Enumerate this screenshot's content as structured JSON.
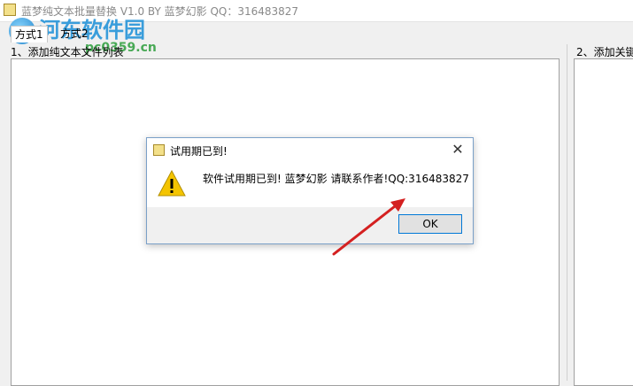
{
  "window": {
    "title": "蓝梦纯文本批量替换 V1.0 BY 蓝梦幻影 QQ：316483827"
  },
  "watermark": {
    "text": "河东软件园",
    "url": "pc0359.cn"
  },
  "tabs": [
    {
      "label": "方式1"
    },
    {
      "label": "方式2"
    }
  ],
  "sections": {
    "left_label": "1、添加纯文本文件列表",
    "right_label": "2、添加关键"
  },
  "dialog": {
    "title": "试用期已到!",
    "message": "软件试用期已到! 蓝梦幻影 请联系作者!QQ:316483827",
    "ok_label": "OK",
    "close_glyph": "✕"
  },
  "colors": {
    "arrow": "#d42020",
    "focus_border": "#0078d7",
    "warning": "#f4c400"
  }
}
